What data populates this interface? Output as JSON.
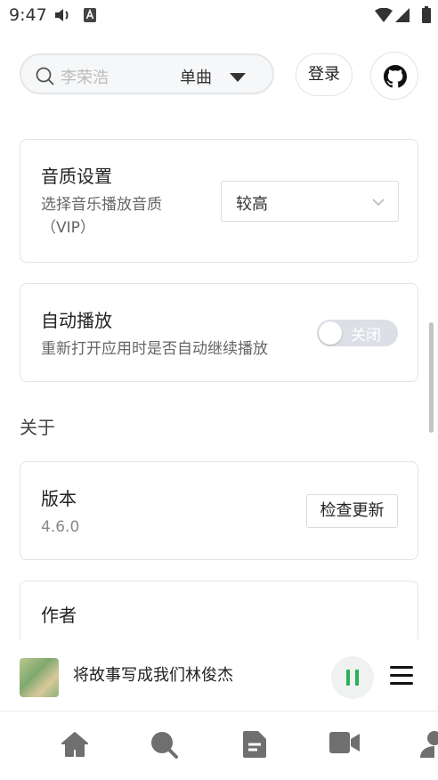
{
  "status_bar": {
    "time": "9:47"
  },
  "header": {
    "search_placeholder": "李荣浩",
    "search_type": "单曲",
    "login_label": "登录"
  },
  "settings": {
    "quality": {
      "title": "音质设置",
      "desc": "选择音乐播放音质（VIP）",
      "selected": "较高"
    },
    "autoplay": {
      "title": "自动播放",
      "desc": "重新打开应用时是否自动继续播放",
      "toggle_label": "关闭",
      "enabled": false
    }
  },
  "about": {
    "section_label": "关于",
    "version": {
      "title": "版本",
      "value": "4.6.0",
      "check_update_label": "检查更新"
    },
    "author": {
      "title": "作者"
    }
  },
  "player": {
    "song_title": "将故事写成我们林俊杰",
    "state": "playing"
  },
  "tabbar": {
    "items": [
      "home-icon",
      "search-icon",
      "document-icon",
      "video-icon",
      "user-icon"
    ]
  },
  "colors": {
    "accent": "#26b15b"
  }
}
